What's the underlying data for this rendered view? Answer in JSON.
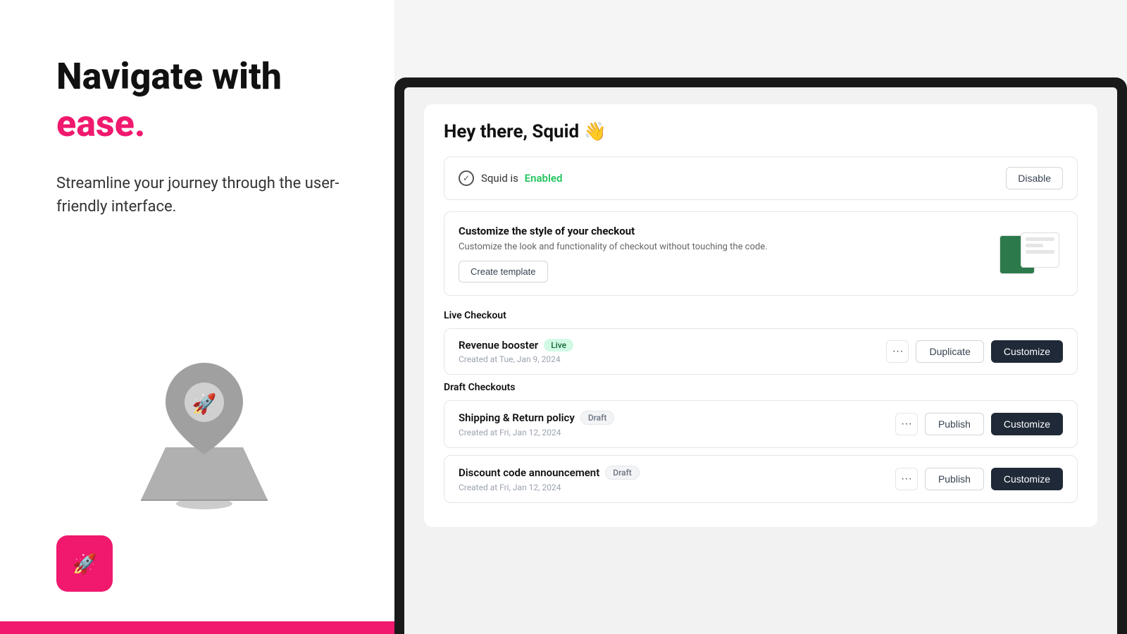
{
  "left": {
    "headline_line1": "Navigate with",
    "headline_line2": "ease.",
    "subtext": "Streamline your journey through the user-friendly interface."
  },
  "app": {
    "greeting": "Hey there, Squid 👋",
    "status": {
      "prefix": "Squid is",
      "status_word": "Enabled",
      "disable_label": "Disable"
    },
    "customize_section": {
      "title": "Customize the style of your checkout",
      "description": "Customize the look and functionality of checkout without touching the code.",
      "create_label": "Create template"
    },
    "live_checkout": {
      "section_label": "Live Checkout",
      "items": [
        {
          "name": "Revenue booster",
          "badge": "Live",
          "badge_type": "live",
          "date": "Created at Tue, Jan 9, 2024",
          "actions": [
            "...",
            "Duplicate",
            "Customize"
          ]
        }
      ]
    },
    "draft_checkouts": {
      "section_label": "Draft Checkouts",
      "items": [
        {
          "name": "Shipping & Return policy",
          "badge": "Draft",
          "badge_type": "draft",
          "date": "Created at Fri, Jan 12, 2024",
          "actions": [
            "...",
            "Publish",
            "Customize"
          ]
        },
        {
          "name": "Discount code announcement",
          "badge": "Draft",
          "badge_type": "draft",
          "date": "Created at Fri, Jan 12, 2024",
          "actions": [
            "...",
            "Publish",
            "Customize"
          ]
        }
      ]
    }
  },
  "colors": {
    "accent": "#f0196e",
    "dark": "#1f2937",
    "enabled_green": "#22c55e"
  }
}
